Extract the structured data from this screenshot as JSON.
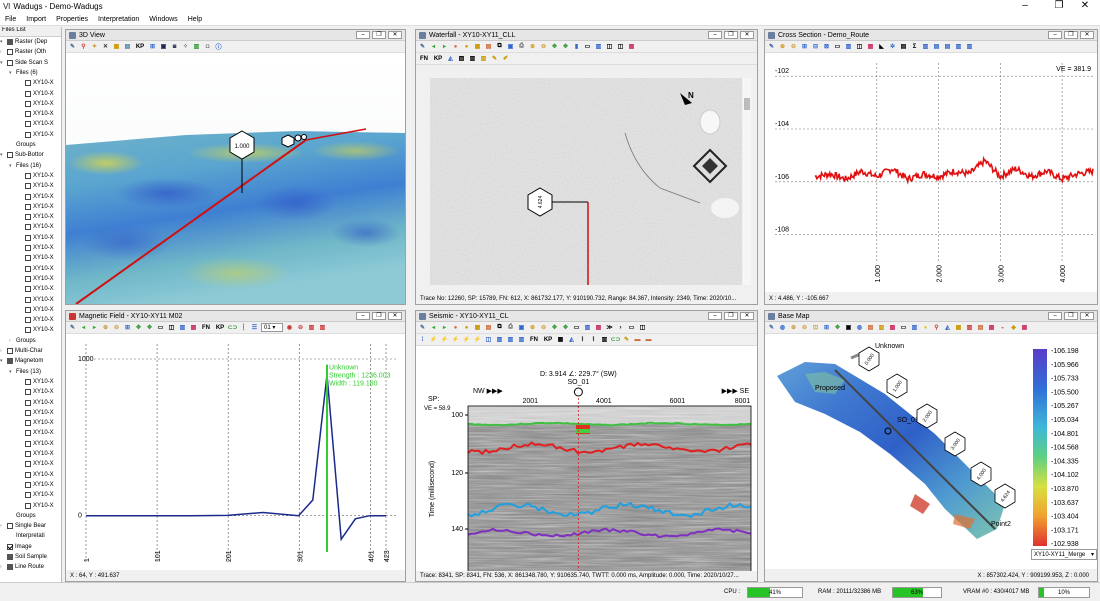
{
  "app": {
    "title": "Wadugs - Demo-Wadugs"
  },
  "menu": [
    "File",
    "Import",
    "Properties",
    "Interpretation",
    "Windows",
    "Help"
  ],
  "files_list": {
    "title": "Files List",
    "items": [
      {
        "label": "Raster (Dep",
        "level": 0,
        "check": "part",
        "expand": "▾"
      },
      {
        "label": "Raster (Oth",
        "level": 0,
        "check": "none",
        "expand": "›"
      },
      {
        "label": "Side Scan S",
        "level": 0,
        "check": "none",
        "expand": "▾"
      },
      {
        "label": "Files (6)",
        "level": 1,
        "check": "nobox",
        "expand": "▾"
      },
      {
        "label": "XY10-X",
        "level": 2,
        "check": "none",
        "expand": ""
      },
      {
        "label": "XY10-X",
        "level": 2,
        "check": "none",
        "expand": ""
      },
      {
        "label": "XY10-X",
        "level": 2,
        "check": "none",
        "expand": ""
      },
      {
        "label": "XY10-X",
        "level": 2,
        "check": "none",
        "expand": ""
      },
      {
        "label": "XY10-X",
        "level": 2,
        "check": "none",
        "expand": ""
      },
      {
        "label": "XY10-X",
        "level": 2,
        "check": "none",
        "expand": ""
      },
      {
        "label": "Groups",
        "level": 1,
        "check": "nobox",
        "expand": ""
      },
      {
        "label": "Sub-Bottor",
        "level": 0,
        "check": "none",
        "expand": "▾"
      },
      {
        "label": "Files (16)",
        "level": 1,
        "check": "nobox",
        "expand": "▾"
      },
      {
        "label": "XY10-X",
        "level": 2,
        "check": "none",
        "expand": ""
      },
      {
        "label": "XY10-X",
        "level": 2,
        "check": "none",
        "expand": ""
      },
      {
        "label": "XY10-X",
        "level": 2,
        "check": "none",
        "expand": ""
      },
      {
        "label": "XY10-X",
        "level": 2,
        "check": "none",
        "expand": ""
      },
      {
        "label": "XY10-X",
        "level": 2,
        "check": "none",
        "expand": ""
      },
      {
        "label": "XY10-X",
        "level": 2,
        "check": "none",
        "expand": ""
      },
      {
        "label": "XY10-X",
        "level": 2,
        "check": "none",
        "expand": ""
      },
      {
        "label": "XY10-X",
        "level": 2,
        "check": "none",
        "expand": ""
      },
      {
        "label": "XY10-X",
        "level": 2,
        "check": "none",
        "expand": ""
      },
      {
        "label": "XY10-X",
        "level": 2,
        "check": "none",
        "expand": ""
      },
      {
        "label": "XY10-X",
        "level": 2,
        "check": "none",
        "expand": ""
      },
      {
        "label": "XY10-X",
        "level": 2,
        "check": "none",
        "expand": ""
      },
      {
        "label": "XY10-X",
        "level": 2,
        "check": "none",
        "expand": ""
      },
      {
        "label": "XY10-X",
        "level": 2,
        "check": "none",
        "expand": ""
      },
      {
        "label": "XY10-X",
        "level": 2,
        "check": "none",
        "expand": ""
      },
      {
        "label": "XY10-X",
        "level": 2,
        "check": "none",
        "expand": ""
      },
      {
        "label": "Groups",
        "level": 1,
        "check": "nobox",
        "expand": "›"
      },
      {
        "label": "Multi-Char",
        "level": 0,
        "check": "none",
        "expand": "›"
      },
      {
        "label": "Magnetom",
        "level": 0,
        "check": "part",
        "expand": "▾"
      },
      {
        "label": "Files (13)",
        "level": 1,
        "check": "nobox",
        "expand": "▾"
      },
      {
        "label": "XY10-X",
        "level": 2,
        "check": "none",
        "expand": ""
      },
      {
        "label": "XY10-X",
        "level": 2,
        "check": "none",
        "expand": ""
      },
      {
        "label": "XY10-X",
        "level": 2,
        "check": "none",
        "expand": ""
      },
      {
        "label": "XY10-X",
        "level": 2,
        "check": "none",
        "expand": ""
      },
      {
        "label": "XY10-X",
        "level": 2,
        "check": "none",
        "expand": ""
      },
      {
        "label": "XY10-X",
        "level": 2,
        "check": "none",
        "expand": ""
      },
      {
        "label": "XY10-X",
        "level": 2,
        "check": "none",
        "expand": ""
      },
      {
        "label": "XY10-X",
        "level": 2,
        "check": "none",
        "expand": ""
      },
      {
        "label": "XY10-X",
        "level": 2,
        "check": "none",
        "expand": ""
      },
      {
        "label": "XY10-X",
        "level": 2,
        "check": "none",
        "expand": ""
      },
      {
        "label": "XY10-X",
        "level": 2,
        "check": "none",
        "expand": ""
      },
      {
        "label": "XY10-X",
        "level": 2,
        "check": "none",
        "expand": ""
      },
      {
        "label": "XY10-X",
        "level": 2,
        "check": "none",
        "expand": ""
      },
      {
        "label": "Groups",
        "level": 1,
        "check": "nobox",
        "expand": ""
      },
      {
        "label": "Single Bear",
        "level": 0,
        "check": "none",
        "expand": "›"
      },
      {
        "label": "Interpretati",
        "level": 1,
        "check": "nobox",
        "expand": ""
      },
      {
        "label": "Image",
        "level": 0,
        "check": "checked",
        "expand": ""
      },
      {
        "label": "Soil Sample",
        "level": 0,
        "check": "part",
        "expand": ""
      },
      {
        "label": "Line Route",
        "level": 0,
        "check": "part",
        "expand": "›"
      }
    ]
  },
  "view3d": {
    "title": "3D View",
    "kp_marker": "1.000"
  },
  "waterfall": {
    "title": "Waterfall - XY10-XY11_CLL",
    "kp_marker": "4.624",
    "status": "Trace No: 12260, SP: 15789, FN: 612, X: 861732.177, Y: 910190.732, Range: 84.367, Intensity: 2349, Time: 2020/10..."
  },
  "cross": {
    "title": "Cross Section - Demo_Route",
    "ve": "VE = 381.9",
    "status": "X : 4.486, Y : -105.667"
  },
  "magnetic": {
    "title": "Magnetic Field - XY10-XY11 M02",
    "combo": "01",
    "annot": [
      "Unknown",
      "Strength : 1236.003",
      "Width : 119.180"
    ],
    "status": "X : 64, Y : 491.637"
  },
  "seismic": {
    "title": "Seismic - XY10-XY11_CL",
    "cursor": "D: 3.914 ∠: 229.7° (SW)",
    "so_label": "SO_01",
    "nw": "NW ▶▶▶",
    "se": "▶▶▶ SE",
    "sp_label": "SP:",
    "ve": "VE = 58.9",
    "ylabel": "Time (millisecond)",
    "status": "Trace: 8341, SP: 8341, FN: 536, X: 861348.780, Y: 910635.740, TWTT: 0.000 ms, Amplitude: 0.000, Time: 2020/10/27..."
  },
  "basemap": {
    "title": "Base Map",
    "labels": {
      "unknown": "Unknown",
      "proposed": "Proposed",
      "so": "SO_01",
      "point2": "Point2"
    },
    "kp_markers": [
      "0.000",
      "1.000",
      "2.000",
      "3.000",
      "4.000",
      "4.624"
    ],
    "legend": [
      "-106.198",
      "-105.966",
      "-105.733",
      "-105.500",
      "-105.267",
      "-105.034",
      "-104.801",
      "-104.568",
      "-104.335",
      "-104.102",
      "-103.870",
      "-103.637",
      "-103.404",
      "-103.171",
      "-102.938"
    ],
    "dataset": "XY10-XY11_Merge",
    "status": "X : 857302.424, Y : 909199.953, Z : 0.000"
  },
  "statusbar": {
    "cpu_label": "CPU :",
    "cpu": "41%",
    "cpu_frac": 0.41,
    "ram": "RAM : 20111/32386 MB",
    "ram_pct": "63%",
    "ram_frac": 0.63,
    "vram": "VRAM #0 : 430/4017 MB",
    "vram_pct": "10%",
    "vram_frac": 0.1
  },
  "chart_data": [
    {
      "type": "line",
      "title": "Cross Section - Demo_Route",
      "x": [
        0.0,
        0.25,
        0.5,
        0.75,
        1.0,
        1.25,
        1.5,
        1.75,
        2.0,
        2.25,
        2.5,
        2.75,
        3.0,
        3.25,
        3.5,
        3.75,
        4.0,
        4.25,
        4.5
      ],
      "y": [
        -105.8,
        -105.7,
        -105.9,
        -105.6,
        -105.8,
        -105.5,
        -105.9,
        -105.7,
        -105.8,
        -105.6,
        -105.7,
        -105.2,
        -105.8,
        -105.5,
        -105.8,
        -105.6,
        -105.9,
        -105.7,
        -105.6
      ],
      "xlim": [
        0.0,
        4.5
      ],
      "ylim": [
        -109,
        -101.5
      ],
      "xticks": [
        "1.000",
        "2.000",
        "3.000",
        "4.000"
      ],
      "yticks": [
        "-102",
        "-104",
        "-106",
        "-108"
      ]
    },
    {
      "type": "line",
      "title": "Magnetic Field - XY10-XY11 M02",
      "x": [
        1,
        50,
        100,
        150,
        200,
        250,
        300,
        320,
        340,
        360,
        380,
        400,
        423
      ],
      "y": [
        0,
        0,
        0,
        0,
        2,
        20,
        0,
        100,
        900,
        -150,
        -20,
        0,
        0
      ],
      "ylim": [
        -200,
        1000
      ],
      "yticks": [
        "1000",
        "0"
      ],
      "xticks": [
        "1",
        "101",
        "201",
        "301",
        "401",
        "423"
      ]
    },
    {
      "type": "heatmap",
      "title": "Seismic - XY10-XY11_CL",
      "xticks": [
        "2001",
        "4001",
        "6001",
        "8001"
      ],
      "yticks": [
        "100",
        "120",
        "140"
      ],
      "ylabel": "Time (millisecond)",
      "horizons": [
        "green",
        "red",
        "cyan",
        "purple"
      ]
    }
  ]
}
